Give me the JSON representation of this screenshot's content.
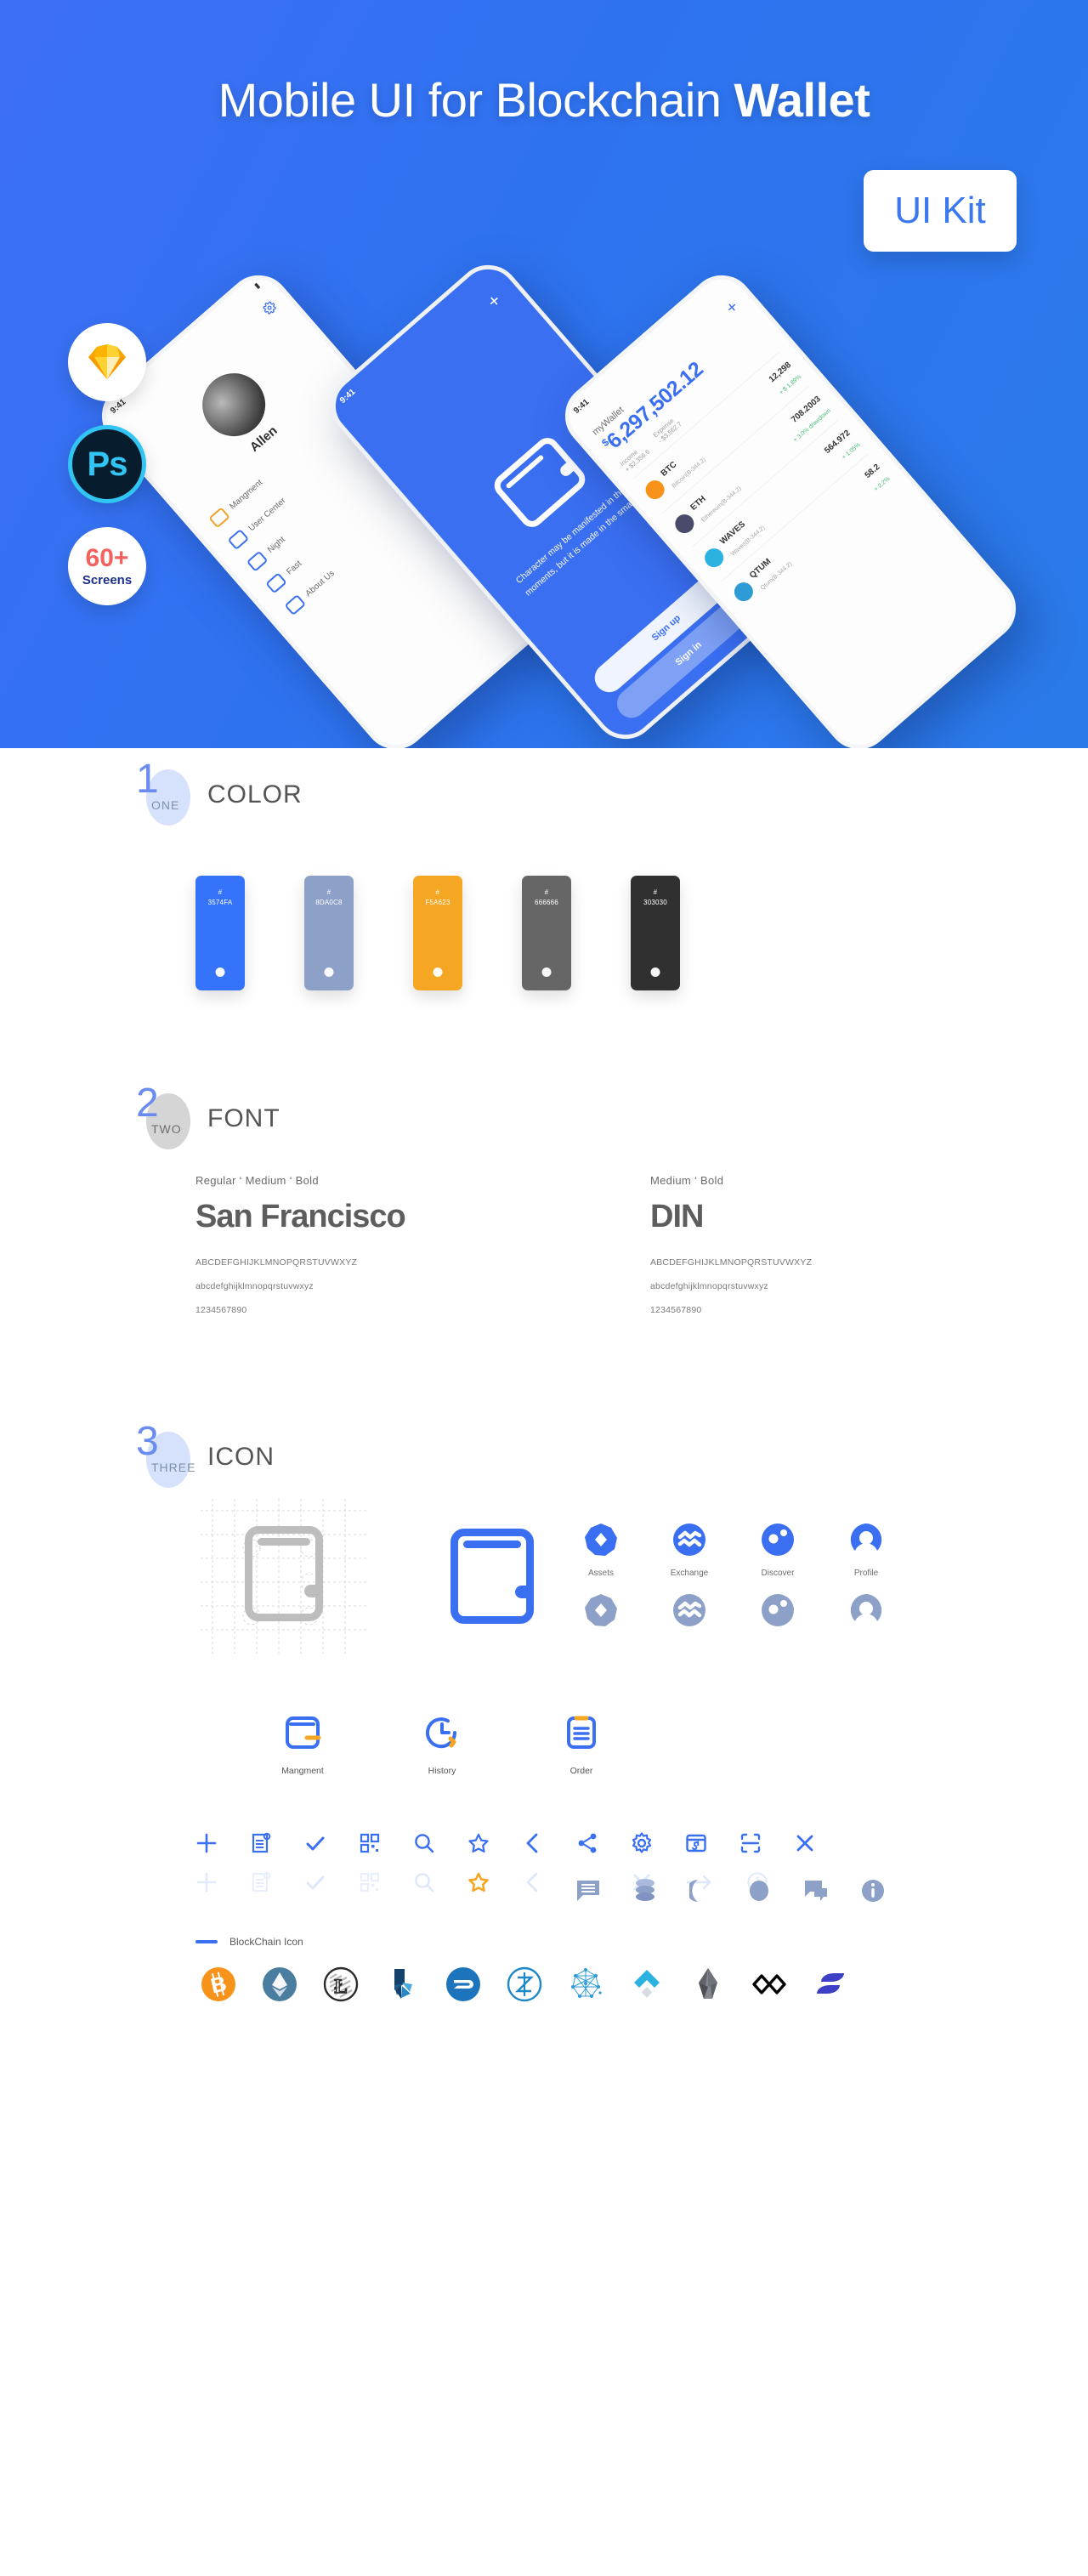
{
  "hero": {
    "title_regular": "Mobile UI for Blockchain ",
    "title_bold": "Wallet",
    "uikit_label": "UI Kit",
    "badges": [
      {
        "name": "sketch-badge",
        "label": ""
      },
      {
        "name": "photoshop-badge",
        "label": "Ps"
      },
      {
        "name": "screens-badge",
        "count": "60+",
        "label": "Screens"
      }
    ],
    "phone1": {
      "time": "9:41",
      "title": "Allen",
      "menu": [
        {
          "label": "Mangment"
        },
        {
          "label": "User Center"
        },
        {
          "label": "Night"
        },
        {
          "label": "Fast"
        },
        {
          "label": "About Us"
        }
      ]
    },
    "phone2": {
      "time": "9:41",
      "caption": "Character may be manifested in the great moments, but it is made in the small ones.",
      "primary_button": "Sign up",
      "secondary_button": "Sign in"
    },
    "phone3": {
      "time": "9:41",
      "wallet_label": "myWallet",
      "currency": "$",
      "amount": "6,297,502.12",
      "stat_income_label": "Income",
      "stat_income_value": "+ $2,356.6",
      "stat_expense_label": "Expense",
      "stat_expense_value": "- $3,562.7",
      "assets": [
        {
          "symbol": "BTC",
          "sub": "Bitcoin(B-344.2)",
          "value": "12,298",
          "change": "+ $ 1.89%"
        },
        {
          "symbol": "ETH",
          "sub": "Ethereum(B-344.2)",
          "value": "708.2003",
          "change": "+ 3.0% drawdown"
        },
        {
          "symbol": "WAVES",
          "sub": "Waves(B-344.2)",
          "value": "564.972",
          "change": "+ 1.05%"
        },
        {
          "symbol": "QTUM",
          "sub": "Qtum(B-344.2)",
          "value": "58.2",
          "change": "+ 2.2%"
        }
      ]
    }
  },
  "sections": {
    "color": {
      "number": "1",
      "word": "ONE",
      "title": "COLOR",
      "swatches": [
        {
          "hash": "#",
          "hex": "3574FA",
          "value": "#3574FA"
        },
        {
          "hash": "#",
          "hex": "8DA0C8",
          "value": "#8DA0C8"
        },
        {
          "hash": "#",
          "hex": "F5A623",
          "value": "#F5A623"
        },
        {
          "hash": "#",
          "hex": "666666",
          "value": "#666666"
        },
        {
          "hash": "#",
          "hex": "303030",
          "value": "#303030"
        }
      ]
    },
    "font": {
      "number": "2",
      "word": "TWO",
      "title": "FONT",
      "families": [
        {
          "weights": "Regular ‘ Medium ‘ Bold",
          "name": "San Francisco",
          "upper": "ABCDEFGHIJKLMNOPQRSTUVWXYZ",
          "lower": "abcdefghijklmnopqrstuvwxyz",
          "digits": "1234567890"
        },
        {
          "weights": "Medium ‘ Bold",
          "name": "DIN",
          "upper": "ABCDEFGHIJKLMNOPQRSTUVWXYZ",
          "lower": "abcdefghijklmnopqrstuvwxyz",
          "digits": "1234567890"
        }
      ]
    },
    "icon": {
      "number": "3",
      "word": "THREE",
      "title": "ICON",
      "nav_icons": [
        {
          "name": "assets-icon",
          "label": "Assets"
        },
        {
          "name": "exchange-icon",
          "label": "Exchange"
        },
        {
          "name": "discover-icon",
          "label": "Discover"
        },
        {
          "name": "profile-icon",
          "label": "Profile"
        }
      ],
      "labeled_icons": [
        {
          "name": "mangment-icon",
          "label": "Mangment"
        },
        {
          "name": "history-icon",
          "label": "History"
        },
        {
          "name": "order-icon",
          "label": "Order"
        }
      ],
      "glyphs": [
        "message-icon",
        "coins-stack-icon",
        "moon-icon",
        "circle-icon",
        "chat-icon",
        "info-icon"
      ],
      "tool_row_primary": [
        "plus-icon",
        "document-settings-icon",
        "check-icon",
        "qrcode-icon",
        "search-icon",
        "star-outline-icon",
        "chevron-left-icon",
        "share-icon",
        "gear-icon",
        "window-icon",
        "scan-icon",
        "close-icon"
      ],
      "tool_row_secondary": [
        "plus-icon-disabled",
        "document-settings-icon-disabled",
        "check-icon-disabled",
        "qrcode-icon-disabled",
        "search-icon-disabled",
        "star-filled-orange-icon",
        "chevron-left-icon-disabled",
        "more-dots-icon",
        "close-icon-disabled",
        "arrow-right-icon",
        "info-circle-icon"
      ],
      "blockchain": {
        "label": "BlockChain Icon",
        "coins": [
          {
            "name": "bitcoin-icon",
            "symbol": "₿",
            "color": "#F7931A"
          },
          {
            "name": "ethereum-icon",
            "symbol": "",
            "color": "#4A7EA0"
          },
          {
            "name": "litecoin-icon",
            "symbol": "Ł",
            "color": "#B8B8B8"
          },
          {
            "name": "bitshares-icon",
            "symbol": "",
            "color": "#1E5C8C"
          },
          {
            "name": "dash-icon",
            "symbol": "",
            "color": "#1C75BC"
          },
          {
            "name": "zcash-icon",
            "symbol": "Ž",
            "color": "#1E88C7"
          },
          {
            "name": "qtum-icon",
            "symbol": "",
            "color": "#2E9BD6"
          },
          {
            "name": "waves-icon",
            "symbol": "",
            "color": "#2BB2E0"
          },
          {
            "name": "eos-icon",
            "symbol": "",
            "color": "#5A5A5A"
          },
          {
            "name": "loopring-icon",
            "symbol": "",
            "color": "#000000"
          },
          {
            "name": "elastos-icon",
            "symbol": "",
            "color": "#3D3FC4"
          }
        ]
      }
    }
  }
}
